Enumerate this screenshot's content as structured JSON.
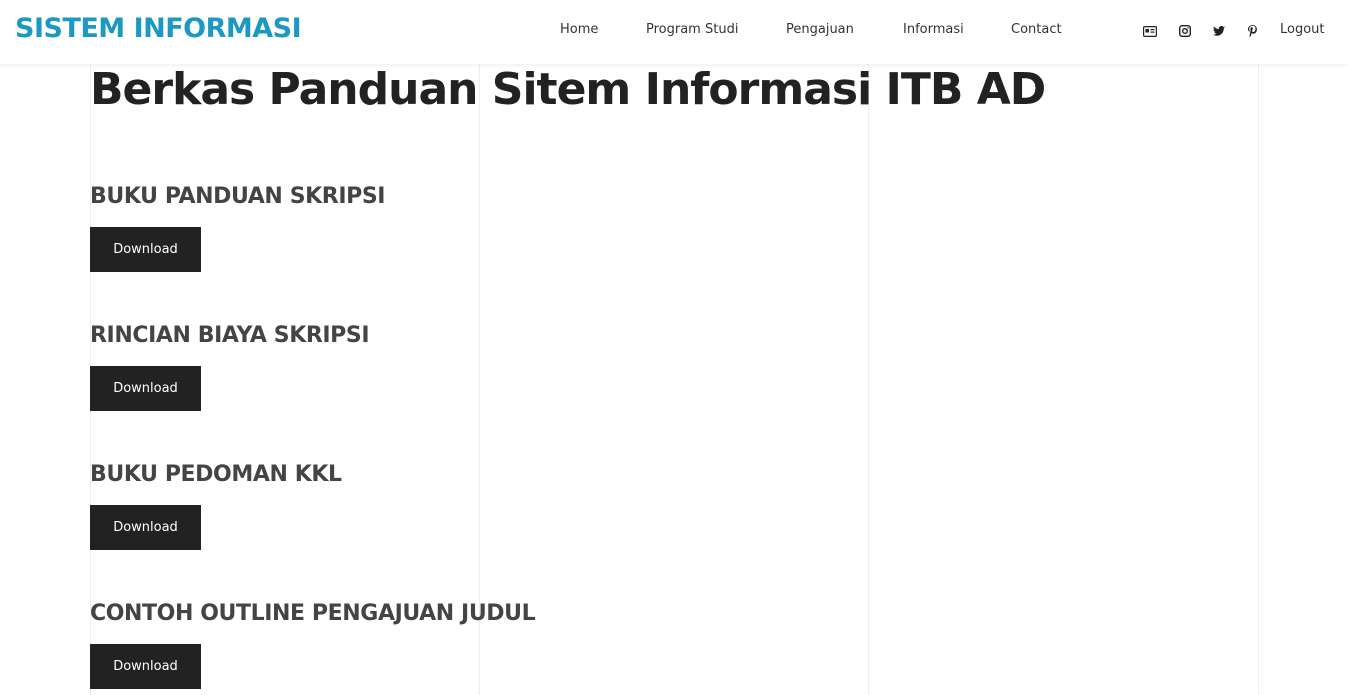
{
  "brand": {
    "title": "SISTEM INFORMASI",
    "color": "#1b99c2"
  },
  "nav": {
    "items": [
      {
        "label": "Home"
      },
      {
        "label": "Program Studi"
      },
      {
        "label": "Pengajuan"
      },
      {
        "label": "Informasi"
      },
      {
        "label": "Contact"
      }
    ],
    "social": [
      {
        "icon": "id-card-icon"
      },
      {
        "icon": "instagram-icon"
      },
      {
        "icon": "twitter-icon"
      },
      {
        "icon": "pinterest-icon"
      }
    ],
    "logout_label": "Logout"
  },
  "page": {
    "title": "Berkas Panduan Sitem Informasi ITB AD",
    "sections": [
      {
        "title": "BUKU PANDUAN SKRIPSI",
        "button_label": "Download"
      },
      {
        "title": "RINCIAN BIAYA SKRIPSI",
        "button_label": "Download"
      },
      {
        "title": "BUKU PEDOMAN KKL",
        "button_label": "Download"
      },
      {
        "title": "CONTOH OUTLINE PENGAJUAN JUDUL",
        "button_label": "Download"
      }
    ]
  },
  "colors": {
    "button_bg": "#222222",
    "heading": "#444444"
  }
}
